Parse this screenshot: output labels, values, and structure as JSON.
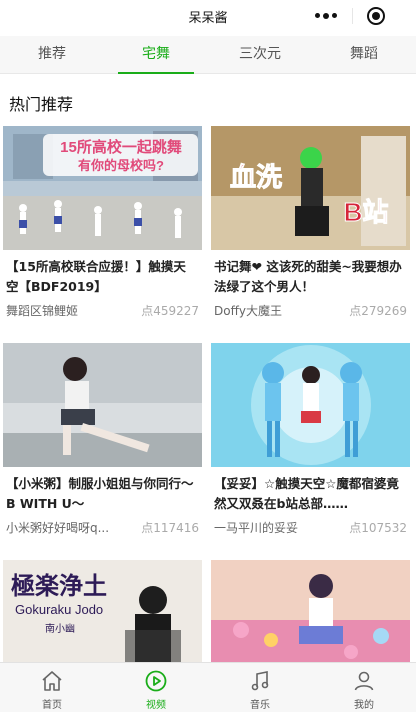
{
  "navbar": {
    "title": "呆呆酱"
  },
  "tabs": [
    {
      "label": "推荐"
    },
    {
      "label": "宅舞"
    },
    {
      "label": "三次元"
    },
    {
      "label": "舞蹈"
    }
  ],
  "active_tab": "宅舞",
  "section": {
    "title": "热门推荐"
  },
  "videos": [
    {
      "title": "【15所高校联合应援！】触摸天空【BDF2019】",
      "author": "舞蹈区锦鲤姬",
      "views": "点459227",
      "thumb_text": "15所高校一起跳舞 有你的母校吗?"
    },
    {
      "title": "书记舞❤ 这该死的甜美~我要想办法绿了这个男人！",
      "author": "Doffy大魔王",
      "views": "点279269",
      "thumb_text": "血洗 B站"
    },
    {
      "title": "【小米粥】制服小姐姐与你同行～B WITH U～",
      "author": "小米粥好好喝呀q...",
      "views": "点117416",
      "thumb_text": ""
    },
    {
      "title": "【妥妥】☆触摸天空☆魔都宿婆竟然又双叒在b站总部……",
      "author": "一马平川的妥妥",
      "views": "点107532",
      "thumb_text": ""
    },
    {
      "title": "",
      "author": "",
      "views": "",
      "thumb_text": "極楽浄土 Gokuraku Jodo 南小幽"
    },
    {
      "title": "",
      "author": "",
      "views": "",
      "thumb_text": ""
    }
  ],
  "bottom_tabs": [
    {
      "label": "首页",
      "icon": "home-icon"
    },
    {
      "label": "视频",
      "icon": "video-icon"
    },
    {
      "label": "音乐",
      "icon": "music-icon"
    },
    {
      "label": "我的",
      "icon": "user-icon"
    }
  ],
  "colors": {
    "accent": "#1aad19",
    "tab_bg": "#f7f7f7"
  }
}
